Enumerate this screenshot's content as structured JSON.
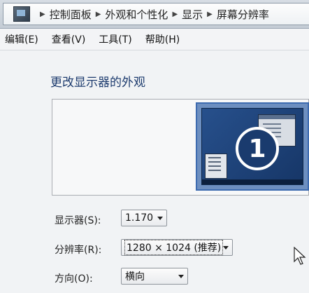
{
  "breadcrumb": [
    "控制面板",
    "外观和个性化",
    "显示",
    "屏幕分辨率"
  ],
  "menu": [
    "编辑(E)",
    "查看(V)",
    "工具(T)",
    "帮助(H)"
  ],
  "heading": "更改显示器的外观",
  "monitor_number": "1",
  "display": {
    "label": "显示器(S):",
    "value": "1.170"
  },
  "resolution": {
    "label": "分辨率(R):",
    "value": "1280 × 1024 (推荐)"
  },
  "orientation": {
    "label": "方向(O):",
    "value": "横向"
  }
}
